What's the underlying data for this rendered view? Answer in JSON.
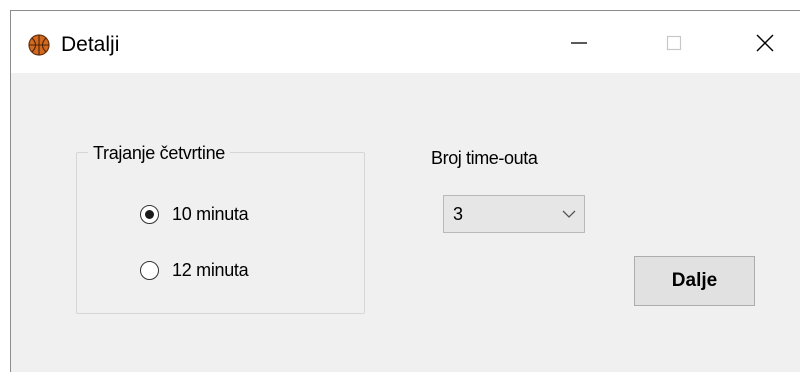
{
  "window": {
    "title": "Detalji",
    "icon": "basketball-icon",
    "controls": [
      "minimize-icon",
      "maximize-icon",
      "close-icon"
    ]
  },
  "quarter_group": {
    "legend": "Trajanje četvrtine",
    "options": [
      {
        "label": "10 minuta",
        "selected": true
      },
      {
        "label": "12 minuta",
        "selected": false
      }
    ]
  },
  "timeouts": {
    "label": "Broj time-outa",
    "selected_value": "3"
  },
  "next_button": {
    "label": "Dalje"
  },
  "colors": {
    "window_bg": "#f0f0f0",
    "titlebar_bg": "#ffffff",
    "basketball": "#d2691e"
  }
}
